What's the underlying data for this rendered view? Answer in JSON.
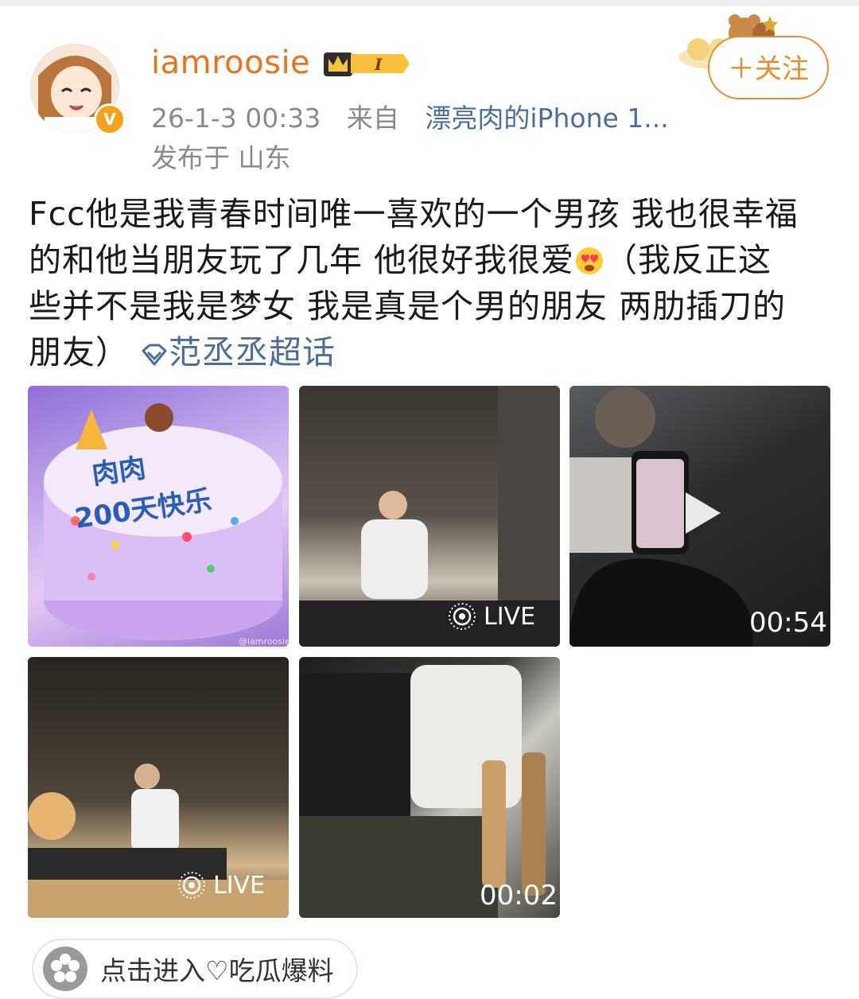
{
  "post": {
    "username": "iamroosie",
    "timestamp": "26-1-3 00:33",
    "from_label": "来自",
    "source_device": "漂亮肉的iPhone 1...",
    "location": "发布于 山东",
    "follow_label": "＋关注",
    "avatar_badge": "V",
    "vip_level": "I",
    "text_line1": "Fcc他是我青春时间唯一喜欢的一个男孩 我也很幸福",
    "text_line2a": "的和他当朋友玩了几年  他很好我很爱",
    "text_line2b": "（我反正这",
    "text_line3": "些并不是我是梦女 我是真是个男的朋友 两肋插刀的",
    "text_line4": "朋友）",
    "topic_label": "范丞丞超话"
  },
  "media": {
    "tile1": {
      "cake_text_top": "肉肉",
      "cake_text_bottom": "200天快乐",
      "watermark": "@iamroosie"
    },
    "tile2": {
      "badge": "LIVE"
    },
    "tile3": {
      "duration": "00:54"
    },
    "tile4": {
      "badge": "LIVE"
    },
    "tile5": {
      "duration": "00:02"
    }
  },
  "footer": {
    "pill_label": "点击进入♡吃瓜爆料"
  },
  "colors": {
    "username": "#e9731c",
    "link": "#4a6e99",
    "follow": "#f08a28",
    "meta": "#8a8a8a"
  },
  "icons": {
    "emoji": "heart-eyes-emoji-icon",
    "topic": "diamond-topic-icon",
    "live": "live-photo-icon",
    "play": "play-icon",
    "pill": "flower-icon"
  }
}
